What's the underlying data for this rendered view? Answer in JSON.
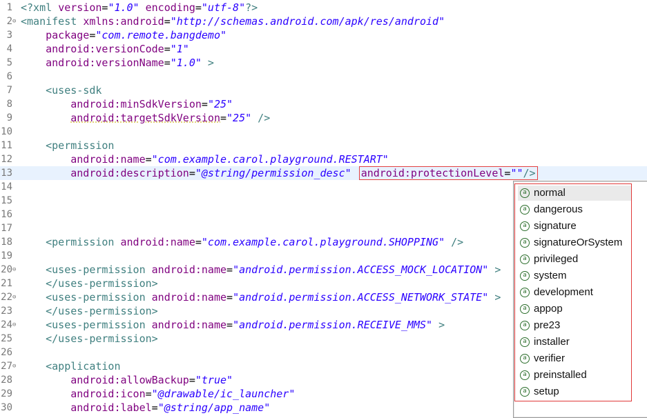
{
  "editor": {
    "lines": [
      {
        "n": "1",
        "segments": [
          {
            "c": "t",
            "s": "<?xml "
          },
          {
            "c": "a",
            "s": "version"
          },
          {
            "c": "p",
            "s": "="
          },
          {
            "c": "v",
            "s": "\"1.0\""
          },
          {
            "c": "a",
            "s": " encoding"
          },
          {
            "c": "p",
            "s": "="
          },
          {
            "c": "v",
            "s": "\"utf-8\""
          },
          {
            "c": "t",
            "s": "?>"
          }
        ]
      },
      {
        "n": "2",
        "fold": true,
        "segments": [
          {
            "c": "t",
            "s": "<manifest "
          },
          {
            "c": "a",
            "s": "xmlns:android"
          },
          {
            "c": "p",
            "s": "="
          },
          {
            "c": "v",
            "s": "\"http://schemas.android.com/apk/res/android\""
          }
        ]
      },
      {
        "n": "3",
        "segments": [
          {
            "c": "p",
            "s": "    "
          },
          {
            "c": "a",
            "s": "package"
          },
          {
            "c": "p",
            "s": "="
          },
          {
            "c": "v",
            "s": "\"com.remote.bangdemo\""
          }
        ]
      },
      {
        "n": "4",
        "segments": [
          {
            "c": "p",
            "s": "    "
          },
          {
            "c": "a",
            "s": "android:versionCode"
          },
          {
            "c": "p",
            "s": "="
          },
          {
            "c": "v",
            "s": "\"1\""
          }
        ]
      },
      {
        "n": "5",
        "segments": [
          {
            "c": "p",
            "s": "    "
          },
          {
            "c": "a",
            "s": "android:versionName"
          },
          {
            "c": "p",
            "s": "="
          },
          {
            "c": "v",
            "s": "\"1.0\""
          },
          {
            "c": "t",
            "s": " >"
          }
        ]
      },
      {
        "n": "6",
        "segments": []
      },
      {
        "n": "7",
        "segments": [
          {
            "c": "p",
            "s": "    "
          },
          {
            "c": "t",
            "s": "<uses-sdk"
          }
        ]
      },
      {
        "n": "8",
        "segments": [
          {
            "c": "p",
            "s": "        "
          },
          {
            "c": "a",
            "s": "android:minSdkVersion"
          },
          {
            "c": "p",
            "s": "="
          },
          {
            "c": "v",
            "s": "\"25\""
          }
        ]
      },
      {
        "n": "9",
        "segments": [
          {
            "c": "p",
            "s": "        "
          },
          {
            "c": "a warn",
            "s": "android:targetSdkVersion"
          },
          {
            "c": "p",
            "s": "="
          },
          {
            "c": "v",
            "s": "\"25\""
          },
          {
            "c": "t",
            "s": " />"
          }
        ]
      },
      {
        "n": "10",
        "segments": []
      },
      {
        "n": "11",
        "segments": [
          {
            "c": "p",
            "s": "    "
          },
          {
            "c": "t",
            "s": "<permission"
          }
        ]
      },
      {
        "n": "12",
        "segments": [
          {
            "c": "p",
            "s": "        "
          },
          {
            "c": "a",
            "s": "android:name"
          },
          {
            "c": "p",
            "s": "="
          },
          {
            "c": "v",
            "s": "\"com.example.carol.playground.RESTART\""
          }
        ]
      },
      {
        "n": "13",
        "current": true,
        "segments": [
          {
            "c": "p",
            "s": "        "
          },
          {
            "c": "a",
            "s": "android:description"
          },
          {
            "c": "p",
            "s": "="
          },
          {
            "c": "v",
            "s": "\"@string/permission_desc\""
          },
          {
            "c": "p",
            "s": " "
          }
        ],
        "highlight": [
          {
            "c": "a",
            "s": "android:protectionLevel"
          },
          {
            "c": "p",
            "s": "="
          },
          {
            "c": "v",
            "s": "\"\""
          },
          {
            "c": "t",
            "s": "/>"
          }
        ]
      },
      {
        "n": "14",
        "segments": []
      },
      {
        "n": "15",
        "segments": []
      },
      {
        "n": "16",
        "segments": []
      },
      {
        "n": "17",
        "segments": []
      },
      {
        "n": "18",
        "segments": [
          {
            "c": "p",
            "s": "    "
          },
          {
            "c": "t",
            "s": "<permission "
          },
          {
            "c": "a",
            "s": "android:name"
          },
          {
            "c": "p",
            "s": "="
          },
          {
            "c": "v",
            "s": "\"com.example.carol.playground.SHOPPING\""
          },
          {
            "c": "t",
            "s": " />"
          }
        ]
      },
      {
        "n": "19",
        "segments": []
      },
      {
        "n": "20",
        "fold": true,
        "segments": [
          {
            "c": "p",
            "s": "    "
          },
          {
            "c": "t",
            "s": "<uses-permission "
          },
          {
            "c": "a",
            "s": "android:name"
          },
          {
            "c": "p",
            "s": "="
          },
          {
            "c": "v",
            "s": "\"android.permission.ACCESS_MOCK_LOCATION\""
          },
          {
            "c": "t",
            "s": " >"
          }
        ]
      },
      {
        "n": "21",
        "segments": [
          {
            "c": "p",
            "s": "    "
          },
          {
            "c": "t",
            "s": "</uses-permission>"
          }
        ]
      },
      {
        "n": "22",
        "fold": true,
        "segments": [
          {
            "c": "p",
            "s": "    "
          },
          {
            "c": "t",
            "s": "<uses-permission "
          },
          {
            "c": "a",
            "s": "android:name"
          },
          {
            "c": "p",
            "s": "="
          },
          {
            "c": "v",
            "s": "\"android.permission.ACCESS_NETWORK_STATE\""
          },
          {
            "c": "t",
            "s": " >"
          }
        ]
      },
      {
        "n": "23",
        "segments": [
          {
            "c": "p",
            "s": "    "
          },
          {
            "c": "t",
            "s": "</uses-permission>"
          }
        ]
      },
      {
        "n": "24",
        "fold": true,
        "segments": [
          {
            "c": "p",
            "s": "    "
          },
          {
            "c": "t",
            "s": "<uses-permission "
          },
          {
            "c": "a",
            "s": "android:name"
          },
          {
            "c": "p",
            "s": "="
          },
          {
            "c": "v",
            "s": "\"android.permission.RECEIVE_MMS\""
          },
          {
            "c": "t",
            "s": " >"
          }
        ]
      },
      {
        "n": "25",
        "segments": [
          {
            "c": "p",
            "s": "    "
          },
          {
            "c": "t",
            "s": "</uses-permission>"
          }
        ]
      },
      {
        "n": "26",
        "segments": []
      },
      {
        "n": "27",
        "fold": true,
        "segments": [
          {
            "c": "p",
            "s": "    "
          },
          {
            "c": "t",
            "s": "<application"
          }
        ]
      },
      {
        "n": "28",
        "segments": [
          {
            "c": "p",
            "s": "        "
          },
          {
            "c": "a",
            "s": "android:allowBackup"
          },
          {
            "c": "p",
            "s": "="
          },
          {
            "c": "v",
            "s": "\"true\""
          }
        ]
      },
      {
        "n": "29",
        "segments": [
          {
            "c": "p",
            "s": "        "
          },
          {
            "c": "a",
            "s": "android:icon"
          },
          {
            "c": "p",
            "s": "="
          },
          {
            "c": "v",
            "s": "\"@drawable/ic_launcher\""
          }
        ]
      },
      {
        "n": "30",
        "segments": [
          {
            "c": "p",
            "s": "        "
          },
          {
            "c": "a",
            "s": "android:label"
          },
          {
            "c": "p",
            "s": "="
          },
          {
            "c": "v",
            "s": "\"@string/app_name\""
          }
        ]
      }
    ]
  },
  "autocomplete": {
    "items": [
      "normal",
      "dangerous",
      "signature",
      "signatureOrSystem",
      "privileged",
      "system",
      "development",
      "appop",
      "pre23",
      "installer",
      "verifier",
      "preinstalled",
      "setup"
    ],
    "selected_index": 0,
    "icon_glyph": "a"
  },
  "colors": {
    "tag": "#3f7f7f",
    "attribute": "#7f007f",
    "value": "#2a00ff",
    "highlight_box": "#e34040"
  }
}
